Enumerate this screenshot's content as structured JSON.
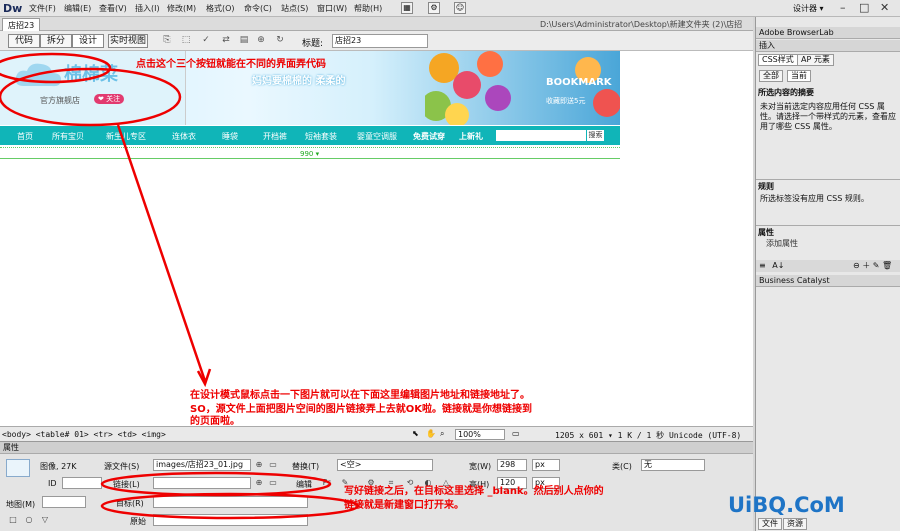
{
  "app": {
    "logo": "Dw",
    "workspace": "设计器 ▾"
  },
  "menu": [
    "文件(F)",
    "编辑(E)",
    "查看(V)",
    "插入(I)",
    "修改(M)",
    "格式(O)",
    "命令(C)",
    "站点(S)",
    "窗口(W)",
    "帮助(H)"
  ],
  "doc": {
    "tab": "店招23",
    "path": "D:\\Users\\Administrator\\Desktop\\新建文件夹 (2)\\店招23.html"
  },
  "toolbar": {
    "code": "代码",
    "split": "拆分",
    "design": "设计",
    "live": "实时视图",
    "title_label": "标题:",
    "title_value": "店招23"
  },
  "banner": {
    "shop_name": "棉棉菜",
    "shop_sub": "官方旗舰店",
    "fav": "❤ 关注",
    "slogan": "妈妈要棉棉的 柔柔的",
    "bookmark": "BOOKMARK",
    "bookmark_sub": "收藏即送5元"
  },
  "nav": [
    "首页",
    "所有宝贝",
    "新生儿专区",
    "连体衣",
    "睡袋",
    "开档裤",
    "短袖套装",
    "婴童空调服",
    "免费试穿",
    "上新礼"
  ],
  "nav_search_btn": "搜索",
  "ruler_label": "990 ▾",
  "annotations": {
    "a1": "点击这个三个按钮就能在不同的界面弄代码",
    "a2": "在设计模式鼠标点击一下图片就可以在下面这里编辑图片地址和链接地址了。",
    "a3": "SO，源文件上面把图片空间的图片链接弄上去就OK啦。链接就是你想链接到",
    "a4": "的页面啦。",
    "a5": "写好链接之后，在目标这里选择 _blank。然后别人点你的",
    "a6": "链接就是新建窗口打开来。"
  },
  "statusbar": {
    "tags": "<body> <table#  01> <tr> <td> <img>",
    "zoom": "100%",
    "info": "1205 x 601 ▾ 1 K / 1 秒 Unicode (UTF-8)"
  },
  "props": {
    "header": "属性",
    "image_label": "图像, 27K",
    "src_label": "源文件(S)",
    "src_value": "images/店招23_01.jpg",
    "link_label": "链接(L)",
    "link_value": "",
    "alt_label": "替换(T)",
    "alt_value": "<空>",
    "edit_label": "编辑",
    "width_label": "宽(W)",
    "width_value": "298",
    "width_unit": "px",
    "height_label": "高(H)",
    "height_value": "120",
    "height_unit": "px",
    "class_label": "类(C)",
    "class_value": "无",
    "id_label": "ID",
    "map_label": "地图(M)",
    "target_label": "目标(R)",
    "target_value": "",
    "original_label": "原始"
  },
  "right": {
    "browserlab": "Adobe BrowserLab",
    "insert": "插入",
    "css_tab": "CSS样式",
    "ap_tab": "AP 元素",
    "all_tab": "全部",
    "current_tab": "当前",
    "summary_title": "所选内容的摘要",
    "summary_text": "未对当前选定内容应用任何 CSS 属性。请选择一个带样式的元素，查看应用了哪些 CSS 属性。",
    "rules_title": "规则",
    "rules_text": "所选标签没有应用 CSS 规则。",
    "attr_title": "属性",
    "add_attr": "添加属性",
    "catalyst": "Business Catalyst",
    "files_tab": "文件",
    "assets_tab": "资源"
  },
  "watermark": "UiBQ.CoM",
  "colors": {
    "accent": "#e00000",
    "nav": "#10b5b8"
  }
}
